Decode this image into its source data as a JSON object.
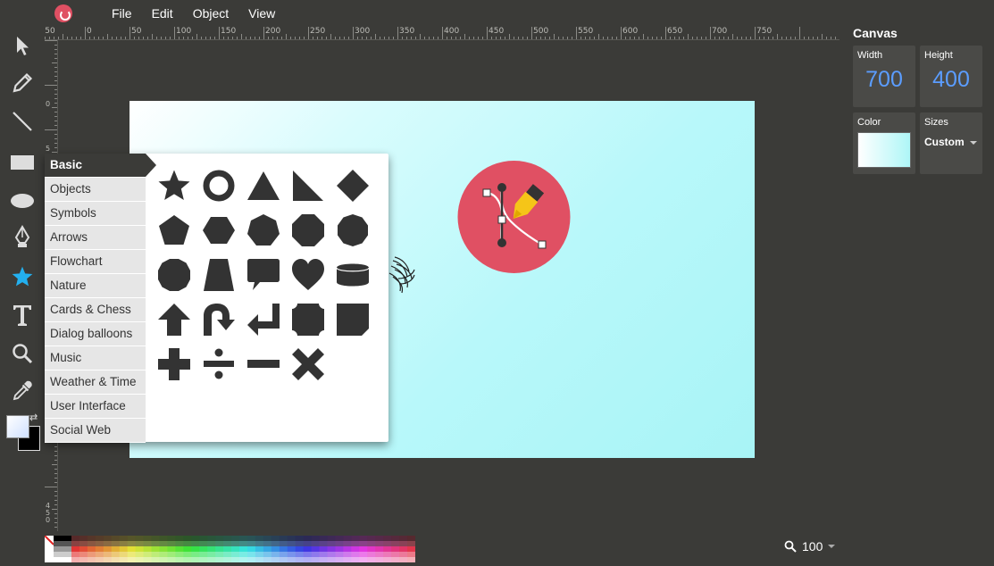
{
  "menubar": {
    "items": [
      "File",
      "Edit",
      "Object",
      "View"
    ]
  },
  "ruler": {
    "top": [
      "-50",
      "0",
      "50",
      "100",
      "150",
      "200",
      "250",
      "300",
      "350",
      "400",
      "450",
      "500",
      "550",
      "600",
      "650",
      "700",
      "750"
    ],
    "left": [
      "0",
      "5",
      "450"
    ]
  },
  "shapes_panel": {
    "categories": [
      "Basic",
      "Objects",
      "Symbols",
      "Arrows",
      "Flowchart",
      "Nature",
      "Cards & Chess",
      "Dialog balloons",
      "Music",
      "Weather & Time",
      "User Interface",
      "Social Web"
    ],
    "active_category": "Basic"
  },
  "right_panel": {
    "title": "Canvas",
    "width_label": "Width",
    "width_value": "700",
    "height_label": "Height",
    "height_value": "400",
    "color_label": "Color",
    "sizes_label": "Sizes",
    "sizes_value": "Custom"
  },
  "zoom": {
    "value": "100"
  },
  "colors": {
    "accent": "#5b9dff",
    "logo": "#e05063",
    "artwork_circle": "#e05063",
    "pen": "#f5c518"
  }
}
